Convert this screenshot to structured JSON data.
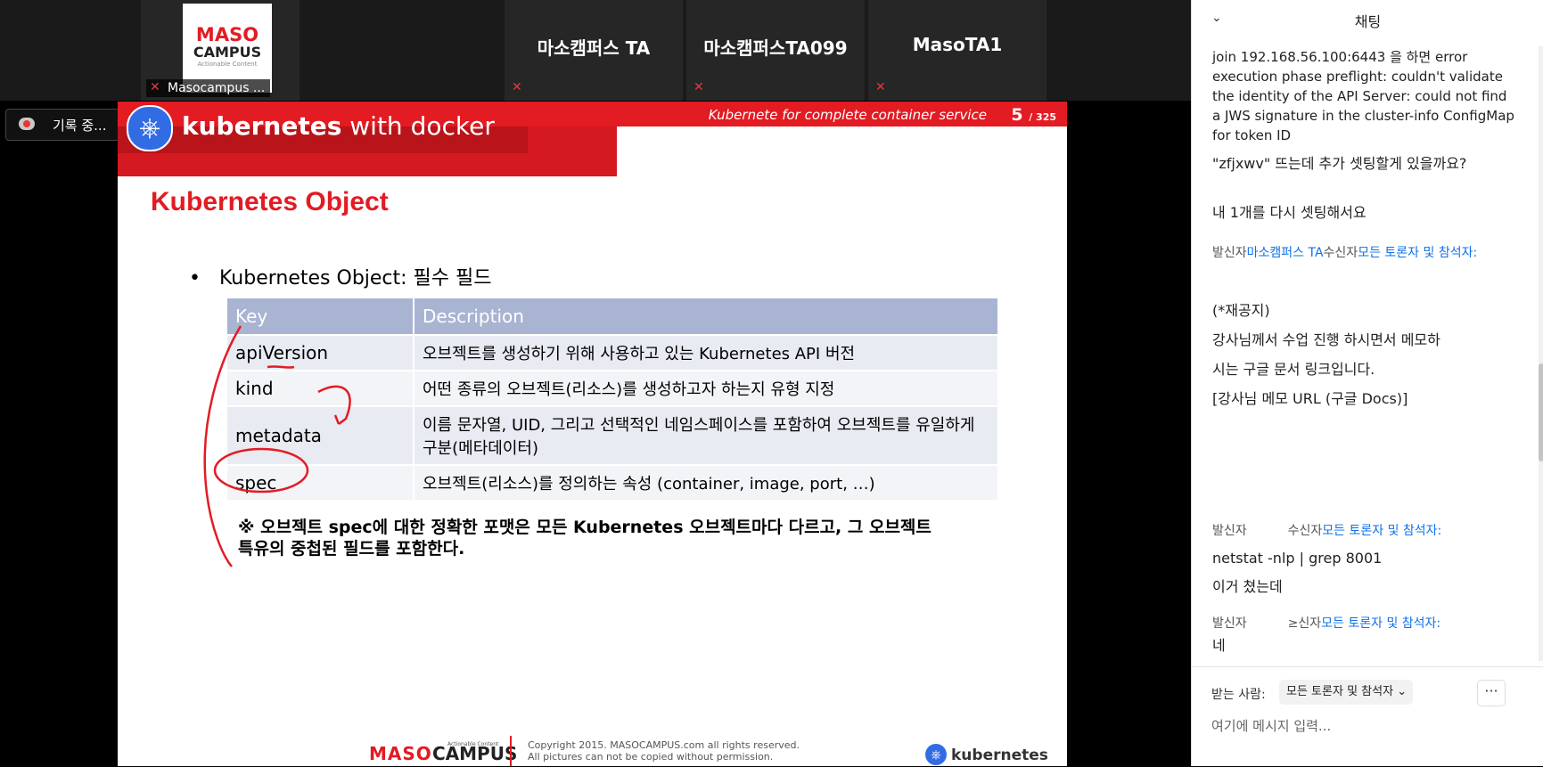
{
  "video_strip": {
    "tiles": [
      {
        "name": "Masocampus ...",
        "logo": {
          "line1": "MASO",
          "line2": "CAMPUS",
          "line3": "Actionable Content"
        }
      },
      {
        "name": "마소캠퍼스 TA"
      },
      {
        "name": "마소캠퍼스TA099"
      },
      {
        "name": "MasoTA1"
      }
    ]
  },
  "recording": {
    "label": "기록 중..."
  },
  "slide": {
    "header_title_bold": "kubernetes",
    "header_title_rest": " with docker",
    "header_subtitle": "Kubernete for complete container service",
    "page_current": "5",
    "page_total": "/ 325",
    "title": "Kubernetes Object",
    "bullet": "Kubernetes Object: 필수 필드",
    "table": {
      "headers": [
        "Key",
        "Description"
      ],
      "rows": [
        {
          "key": "apiVersion",
          "desc": "오브젝트를 생성하기 위해 사용하고 있는 Kubernetes API 버전"
        },
        {
          "key": "kind",
          "desc": "어떤 종류의 오브젝트(리소스)를 생성하고자 하는지 유형 지정"
        },
        {
          "key": "metadata",
          "desc": "이름 문자열, UID, 그리고 선택적인 네임스페이스를 포함하여 오브젝트를 유일하게 구분(메타데이터)"
        },
        {
          "key": "spec",
          "desc": "오브젝트(리소스)를 정의하는 속성 (container, image, port, …)"
        }
      ]
    },
    "note": "※ 오브젝트 spec에 대한 정확한 포맷은 모든 Kubernetes 오브젝트마다 다르고, 그 오브젝트 특유의 중첩된 필드를 포함한다.",
    "footer": {
      "maso": "MASO",
      "campus": "CAMPUS",
      "actionable": "Actionable Content",
      "copyright_1": "Copyright 2015. MASOCAMPUS.com all rights reserved.",
      "copyright_2": "All pictures can not be copied without permission.",
      "k8s": "kubernetes"
    }
  },
  "chat": {
    "title": "채팅",
    "messages": [
      {
        "text": "join 192.168.56.100:6443 을 하면 error execution phase preflight: couldn't validate the identity of the API Server: could not find a JWS signature in the cluster-info ConfigMap for token ID"
      },
      {
        "text": "\"zfjxwv\" 뜨는데 추가 셋팅할게 있을까요?"
      },
      {
        "text": "내 1개를 다시 셋팅해서요"
      }
    ],
    "meta1": {
      "from_label": "발신자",
      "from": "마소캠퍼스 TA",
      "to_label": "수신자",
      "to": "모든 토론자 및 참석자:"
    },
    "notice": [
      "(*재공지)",
      "강사님께서 수업 진행 하시면서 메모하",
      "시는 구글 문서 링크입니다.",
      "[강사님 메모 URL (구글 Docs)]"
    ],
    "meta2": {
      "from_label": "발신자",
      "to_label": "수신자",
      "to": "모든 토론자 및 참석자:"
    },
    "msg2": [
      "netstat -nlp | grep 8001",
      "이거 쳤는데"
    ],
    "meta3": {
      "from_label": "발신자",
      "to_label": "≥신자",
      "to": "모든 토론자 및 참석자:"
    },
    "msg3": "네",
    "footer": {
      "to_label": "받는 사람:",
      "to_value": "모든 토론자 및 참석자",
      "more": "···",
      "placeholder": "여기에 메시지 입력..."
    }
  }
}
